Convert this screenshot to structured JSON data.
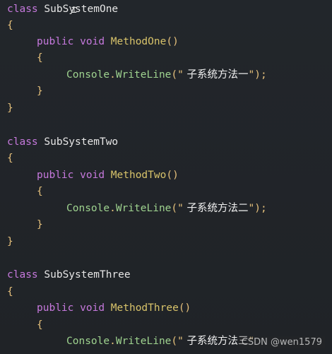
{
  "code": {
    "blocks": [
      {
        "class_kw": "class",
        "class_name": "SubSystemOne",
        "open_brace": "{",
        "method_mod": "public",
        "method_type": "void",
        "method_name": "MethodOne",
        "method_parens": "()",
        "inner_open": "{",
        "console": "Console",
        "dot": ".",
        "writeline": "WriteLine",
        "call_open": "(\"",
        "string_text": " 子系统方法一",
        "call_close": "\");",
        "inner_close": "}",
        "close_brace": "}"
      },
      {
        "class_kw": "class",
        "class_name": "SubSystemTwo",
        "open_brace": "{",
        "method_mod": "public",
        "method_type": "void",
        "method_name": "MethodTwo",
        "method_parens": "()",
        "inner_open": "{",
        "console": "Console",
        "dot": ".",
        "writeline": "WriteLine",
        "call_open": "(\"",
        "string_text": " 子系统方法二",
        "call_close": "\");",
        "inner_close": "}",
        "close_brace": "}"
      },
      {
        "class_kw": "class",
        "class_name": "SubSystemThree",
        "open_brace": "{",
        "method_mod": "public",
        "method_type": "void",
        "method_name": "MethodThree",
        "method_parens": "()",
        "inner_open": "{",
        "console": "Console",
        "dot": ".",
        "writeline": "WriteLine",
        "call_open": "(\"",
        "string_text": " 子系统方法三",
        "call_close": "\""
      }
    ]
  },
  "cursor_glyph": "⌶",
  "watermark": "CSDN @wen1579"
}
